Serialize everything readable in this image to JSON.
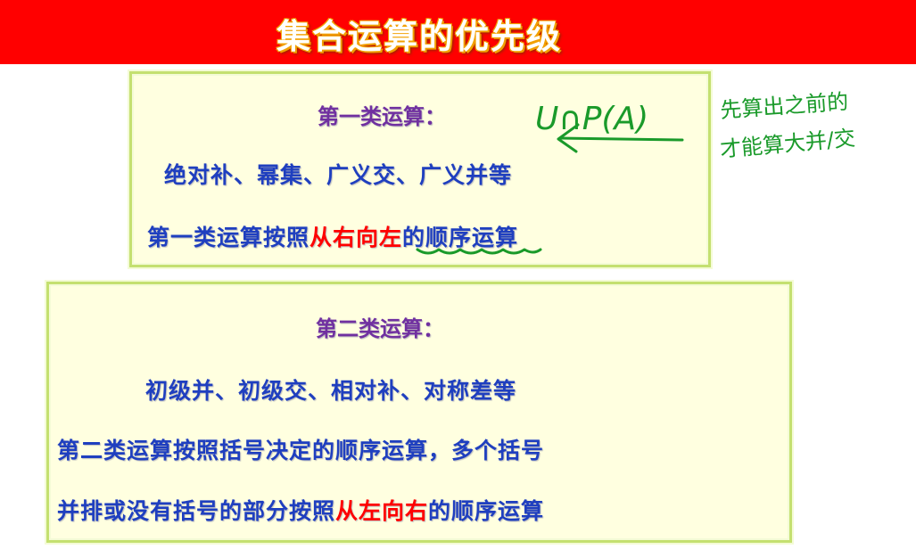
{
  "title": "集合运算的优先级",
  "box1": {
    "heading": "第一类运算：",
    "operations": "绝对补、幂集、广义交、广义并等",
    "rule_prefix": "第一类运算按照",
    "rule_highlight": "从右向左",
    "rule_suffix": "的顺序运算"
  },
  "box2": {
    "heading": "第二类运算：",
    "operations": "初级并、初级交、相对补、对称差等",
    "rule_line1": "第二类运算按照括号决定的顺序运算，多个括号",
    "rule_line2_prefix": "并排或没有括号的部分按照",
    "rule_line2_highlight": "从左向右",
    "rule_line2_suffix": "的顺序运算"
  },
  "annotations": {
    "formula": "U∩P(A)",
    "note_line1": "先算出之前的",
    "note_line2": "才能算大并/交"
  },
  "colors": {
    "title_bar": "#ff0000",
    "heading": "#7030a0",
    "body_text": "#1f3fbf",
    "highlight": "#ff0000",
    "ink_green": "#1a9a2a"
  }
}
